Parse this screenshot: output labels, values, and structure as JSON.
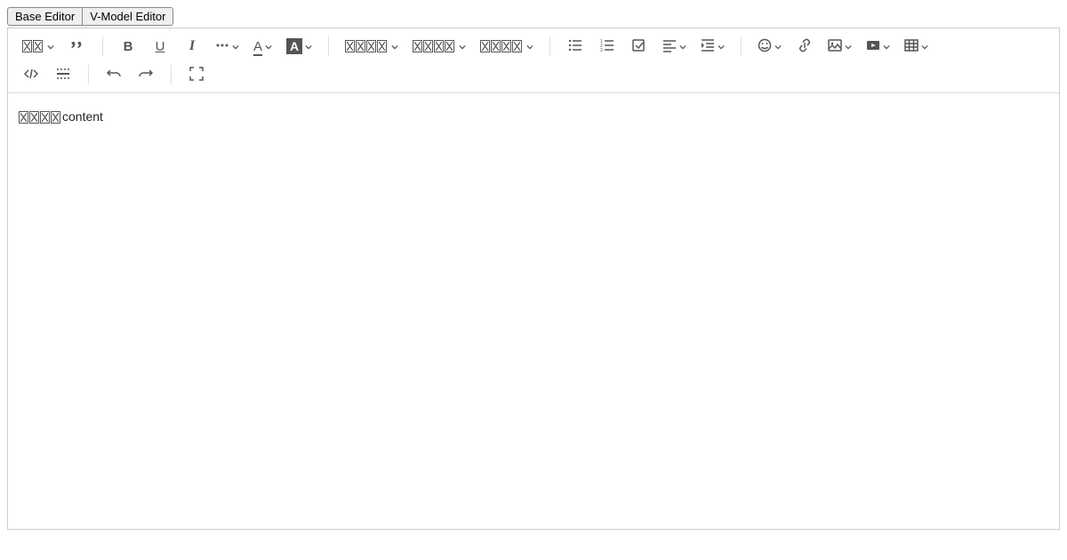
{
  "tabs": {
    "base": "Base Editor",
    "vmodel": "V-Model Editor"
  },
  "toolbar": {
    "style_label": "樣式",
    "paragraph_label": "段落樣式",
    "fontname_label": "字體名稱",
    "fontsize_label": "字體大小",
    "bold_char": "B",
    "underline_char": "U",
    "italic_char": "I",
    "fontcolor_char": "A",
    "highlight_char": "A"
  },
  "content": {
    "prefix_glyph_count": 4,
    "text": "content"
  }
}
